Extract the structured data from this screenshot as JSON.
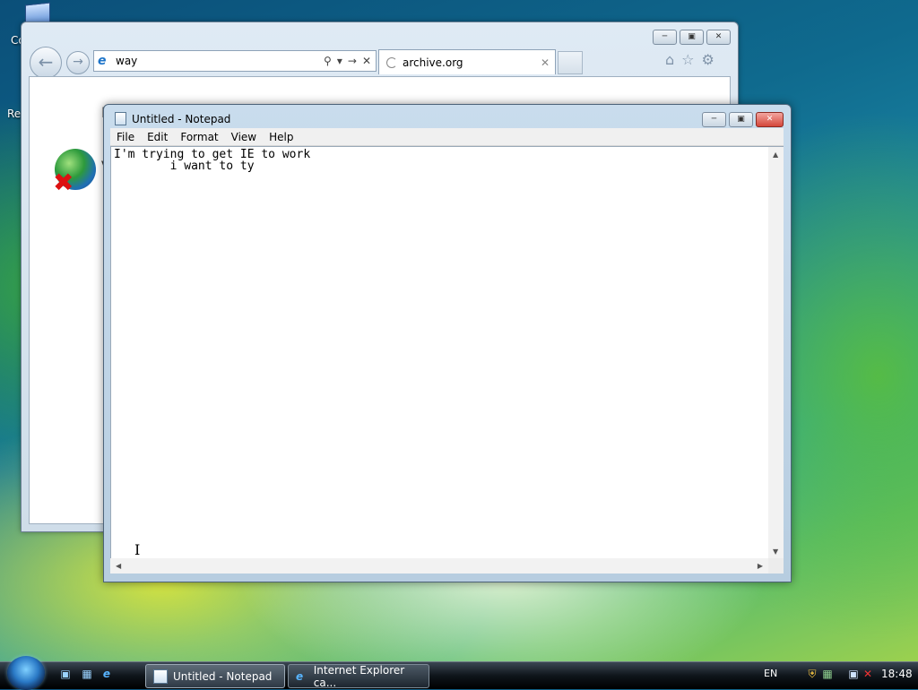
{
  "desktop": {
    "icon_label_1": "Co",
    "icon_label_2": "Re"
  },
  "ie": {
    "address_value": "way",
    "tab_title": "archive.org",
    "content_heading_partial": "I",
    "content_line_partial": "V"
  },
  "notepad": {
    "title": "Untitled - Notepad",
    "menu": [
      "File",
      "Edit",
      "Format",
      "View",
      "Help"
    ],
    "text": "I'm trying to get IE to work\n        i want to ty"
  },
  "taskbar": {
    "buttons": [
      {
        "label": "Untitled - Notepad"
      },
      {
        "label": "Internet Explorer ca..."
      }
    ],
    "language": "EN",
    "clock": "18:48"
  }
}
